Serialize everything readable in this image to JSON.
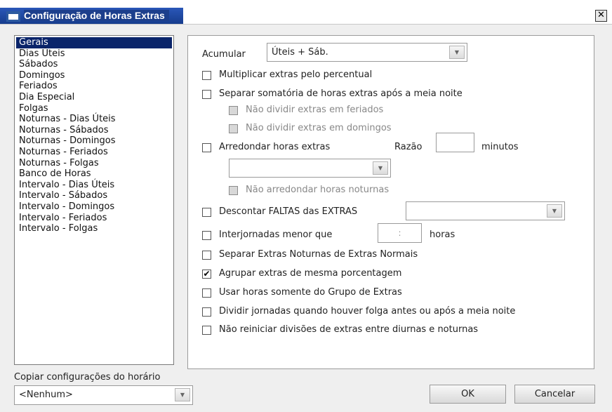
{
  "window": {
    "title": "Configuração de Horas Extras",
    "close_label": "✕"
  },
  "sidebar": {
    "items": [
      {
        "label": "Gerais",
        "selected": true
      },
      {
        "label": "Dias Úteis"
      },
      {
        "label": "Sábados"
      },
      {
        "label": "Domingos"
      },
      {
        "label": "Feriados"
      },
      {
        "label": "Dia Especial"
      },
      {
        "label": "Folgas"
      },
      {
        "label": "Noturnas - Dias Úteis"
      },
      {
        "label": "Noturnas - Sábados"
      },
      {
        "label": "Noturnas - Domingos"
      },
      {
        "label": "Noturnas - Feriados"
      },
      {
        "label": "Noturnas - Folgas"
      },
      {
        "label": "Banco de Horas"
      },
      {
        "label": "Intervalo - Dias Úteis"
      },
      {
        "label": "Intervalo - Sábados"
      },
      {
        "label": "Intervalo - Domingos"
      },
      {
        "label": "Intervalo - Feriados"
      },
      {
        "label": "Intervalo - Folgas"
      }
    ]
  },
  "settings": {
    "acumular_label": "Acumular",
    "acumular_value": "Úteis + Sáb.",
    "multiplicar": {
      "label": "Multiplicar extras pelo percentual",
      "checked": false
    },
    "separar_somatoria": {
      "label": "Separar somatória de horas extras após a meia noite",
      "checked": false
    },
    "nao_dividir_feriados": {
      "label": "Não dividir extras em feriados",
      "checked": false
    },
    "nao_dividir_domingos": {
      "label": "Não dividir extras em domingos",
      "checked": false
    },
    "arredondar": {
      "label": "Arredondar horas extras",
      "checked": false
    },
    "razao_label": "Razão",
    "razao_value": "",
    "minutos_label": "minutos",
    "arredondar_combo_value": "",
    "nao_arredondar_noturnas": {
      "label": "Não arredondar horas noturnas",
      "checked": false
    },
    "descontar_faltas": {
      "label": "Descontar FALTAS das EXTRAS",
      "checked": false
    },
    "descontar_combo_value": "",
    "interjornadas": {
      "label": "Interjornadas menor que",
      "checked": false
    },
    "interjornadas_value": ":",
    "horas_label": "horas",
    "separar_noturnas": {
      "label": "Separar Extras Noturnas de Extras Normais",
      "checked": false
    },
    "agrupar": {
      "label": "Agrupar extras de mesma porcentagem",
      "checked": true
    },
    "usar_grupo": {
      "label": "Usar horas somente do Grupo de Extras",
      "checked": false
    },
    "dividir_jornadas": {
      "label": "Dividir jornadas quando houver folga antes ou após a meia noite",
      "checked": false
    },
    "nao_reiniciar": {
      "label": "Não reiniciar divisões de extras entre diurnas e noturnas",
      "checked": false
    }
  },
  "footer": {
    "copiar_label": "Copiar configurações do horário",
    "copiar_value": "<Nenhum>",
    "ok_label": "OK",
    "cancel_label": "Cancelar"
  }
}
